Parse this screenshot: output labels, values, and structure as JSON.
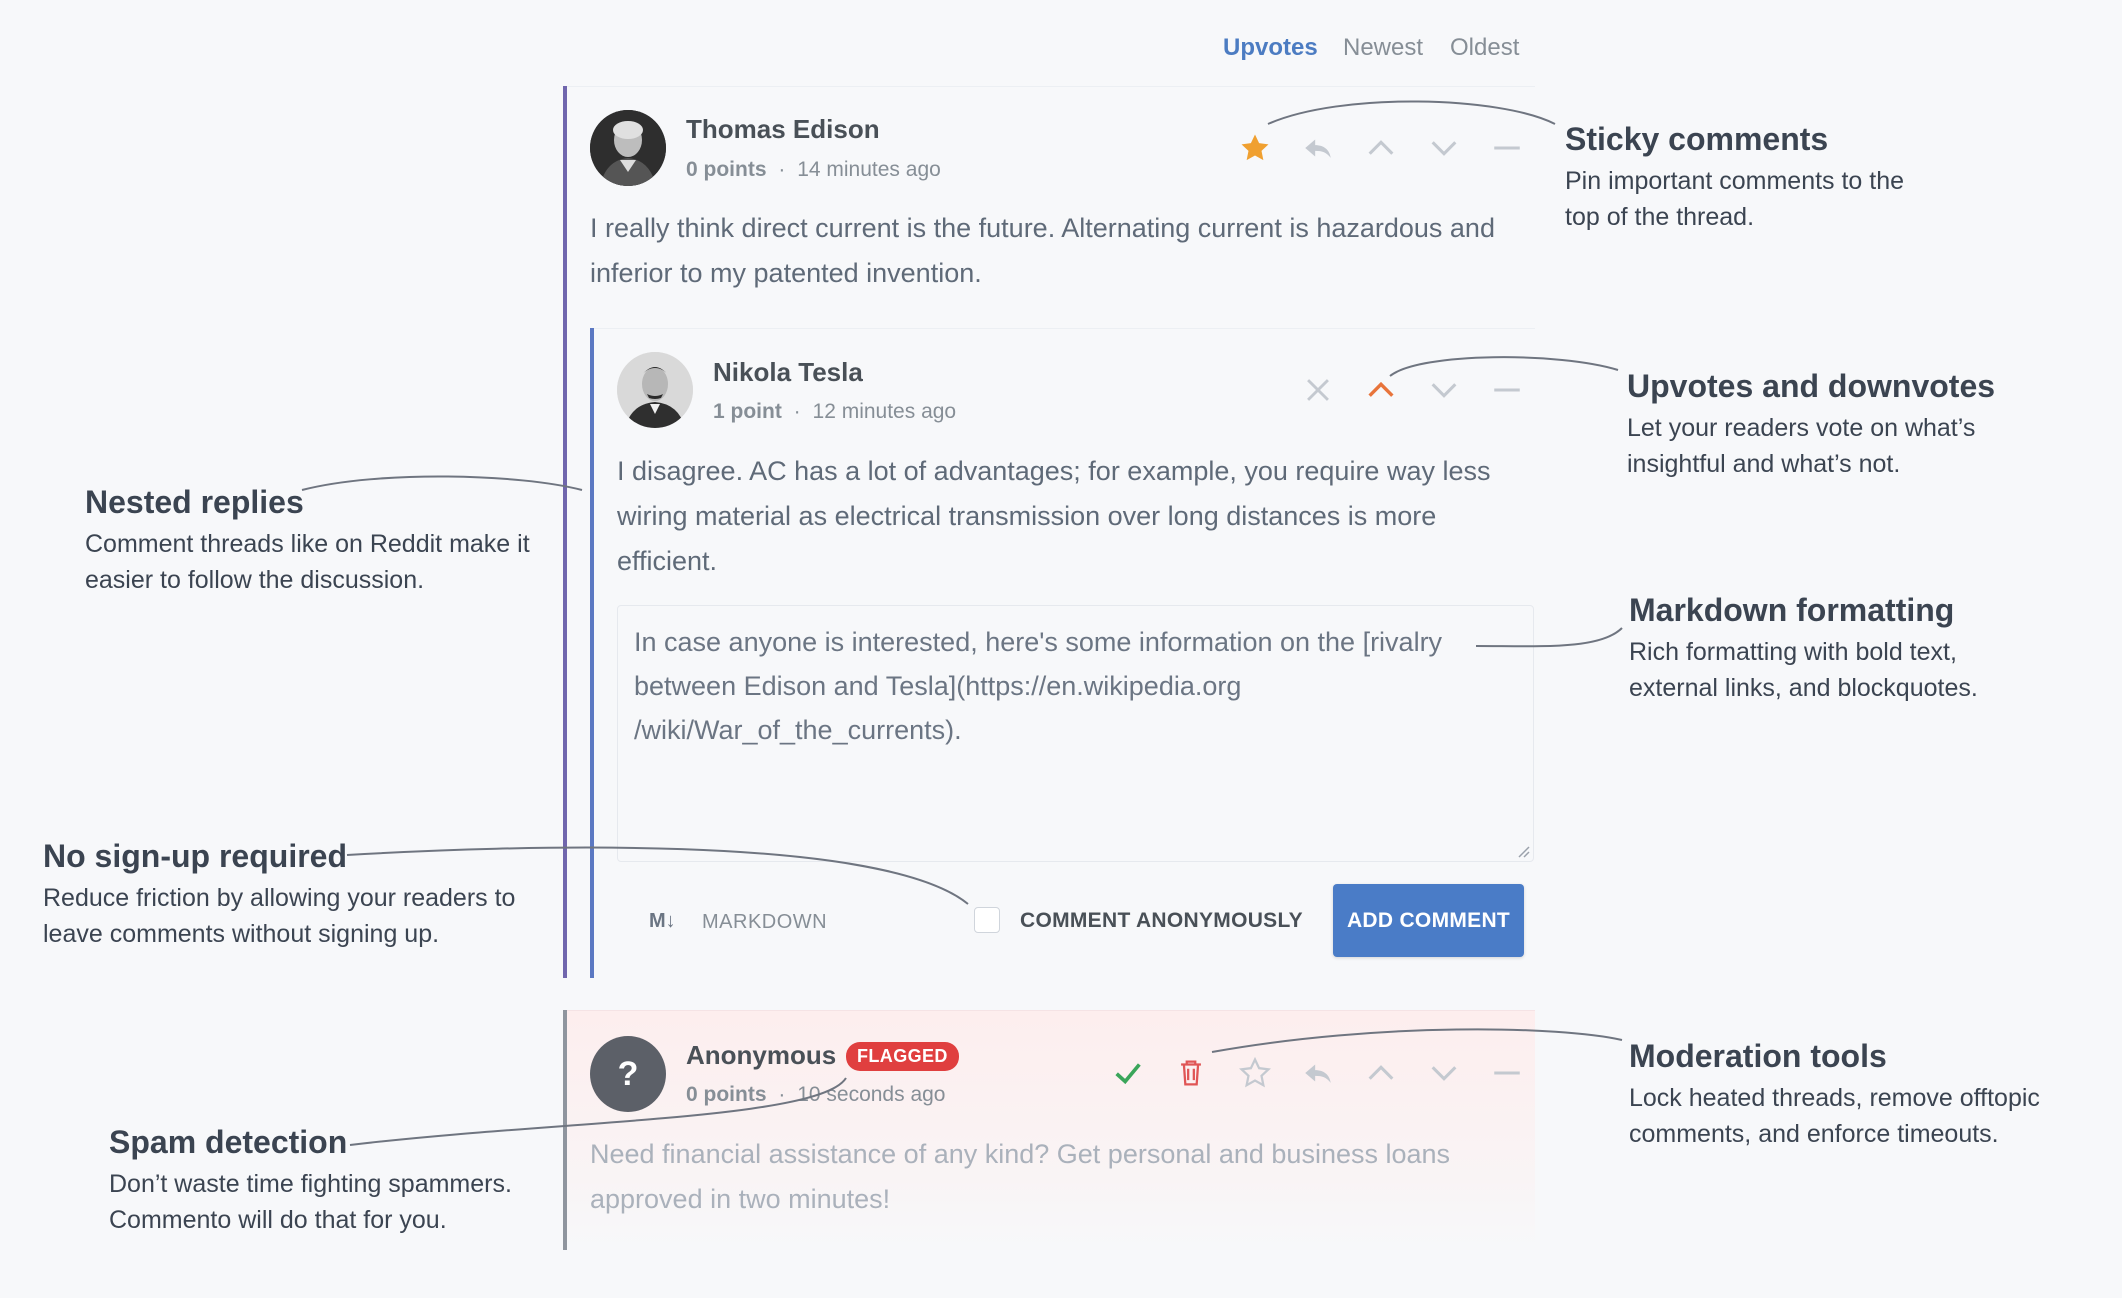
{
  "sort": {
    "tabs": [
      "Upvotes",
      "Newest",
      "Oldest"
    ]
  },
  "comments": [
    {
      "author": "Thomas Edison",
      "points": "0 points",
      "time": "14 minutes ago",
      "text": "I really think direct current is the future. Alternating current is hazardous and inferior to my patented invention."
    },
    {
      "author": "Nikola Tesla",
      "points": "1 point",
      "time": "12 minutes ago",
      "text": "I disagree. AC has a lot of advantages; for example, you require way less wiring material as electrical transmission over long distances is more efficient."
    },
    {
      "author": "Anonymous",
      "badge": "FLAGGED",
      "avatar_glyph": "?",
      "points": "0 points",
      "time": "10 seconds ago",
      "text": "Need financial assistance of any kind? Get personal and business loans approved in two minutes!"
    }
  ],
  "separator": "·",
  "reply_box": {
    "value": "In case anyone is interested, here's some information on the [rivalry between Edison and Tesla](https://en.wikipedia.org /wiki/War_of_the_currents).",
    "markdown_logo": "M↓",
    "markdown_label": "MARKDOWN",
    "anonymous_label": "COMMENT ANONYMOUSLY",
    "submit_label": "ADD COMMENT"
  },
  "annotations": {
    "sticky": {
      "title": "Sticky comments",
      "desc": "Pin important comments to the top of the thread."
    },
    "votes": {
      "title": "Upvotes and downvotes",
      "desc": "Let your readers vote on what’s insightful and what’s not."
    },
    "markdown": {
      "title": "Markdown formatting",
      "desc": "Rich formatting with bold text, external links, and blockquotes."
    },
    "moderation": {
      "title": "Moderation tools",
      "desc": "Lock heated threads, remove offtopic comments, and enforce timeouts."
    },
    "nested": {
      "title": "Nested replies",
      "desc": "Comment threads like on Reddit make it easier to follow the discussion."
    },
    "signup": {
      "title": "No sign-up required",
      "desc": "Reduce friction by allowing your readers to leave comments without signing up."
    },
    "spam": {
      "title": "Spam detection",
      "desc": "Don’t waste time fighting spammers. Commento will do that for you."
    }
  },
  "colors": {
    "accent": "#4a7cc7",
    "upvote_active": "#e8743b",
    "star_active": "#f0a030",
    "flag": "#e03f3f",
    "approve": "#3aa55a",
    "thread_bar": "#6b5fa8"
  },
  "icons": [
    "star-icon",
    "reply-icon",
    "upvote-icon",
    "downvote-icon",
    "collapse-icon",
    "close-icon",
    "approve-icon",
    "trash-icon"
  ]
}
